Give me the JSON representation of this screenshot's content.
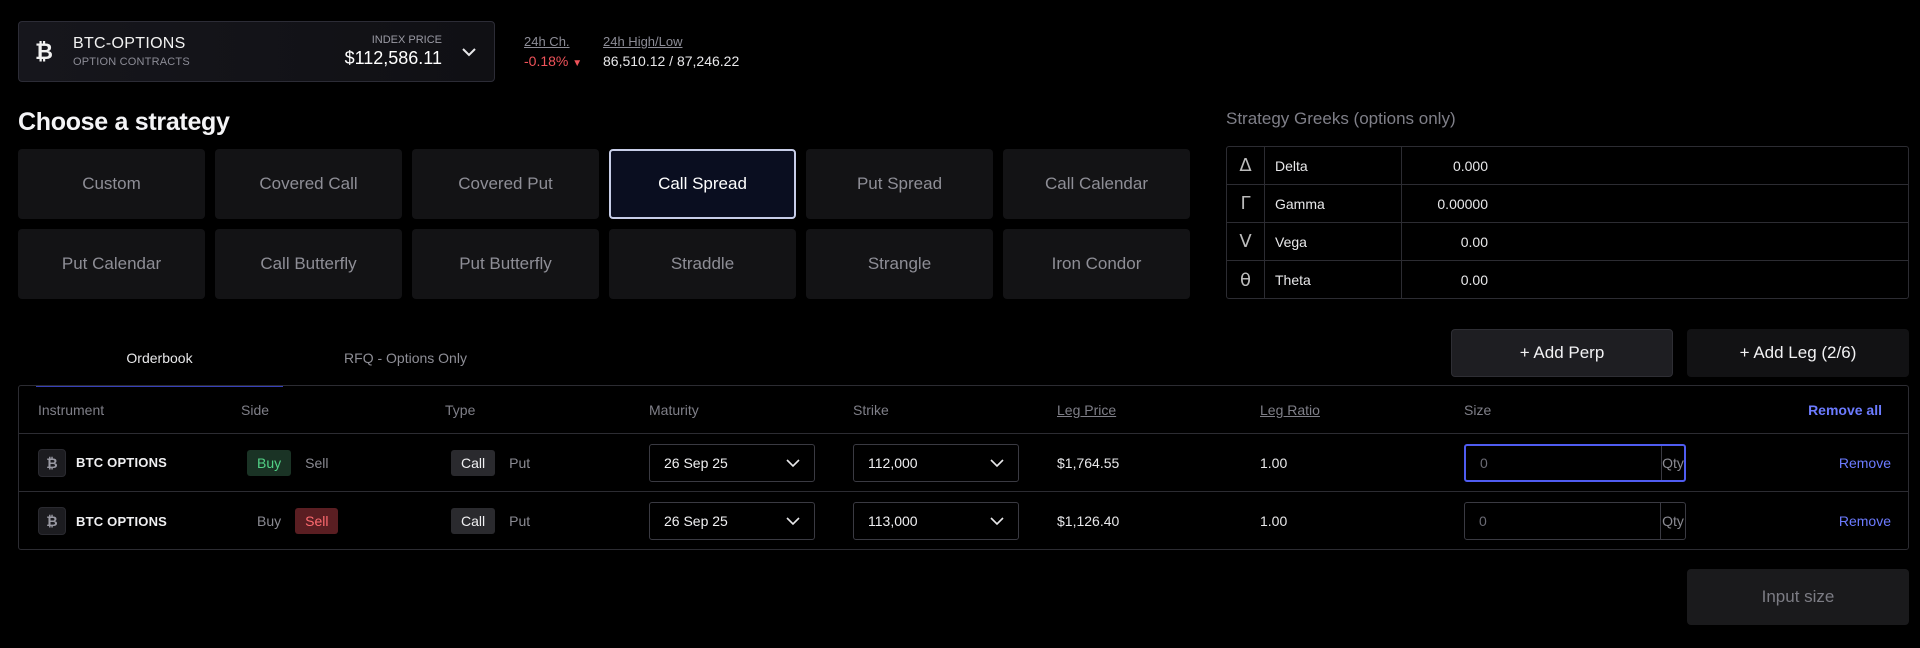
{
  "market": {
    "name": "BTC-OPTIONS",
    "subtitle": "OPTION CONTRACTS",
    "index_label": "INDEX PRICE",
    "index_price": "$112,586.11",
    "icon": "bitcoin-icon"
  },
  "stats": {
    "change_label": "24h Ch.",
    "change_value": "-0.18%",
    "highlow_label": "24h High/Low",
    "highlow_value": "86,510.12 / 87,246.22"
  },
  "strategy": {
    "title": "Choose a strategy",
    "options": [
      "Custom",
      "Covered Call",
      "Covered Put",
      "Call Spread",
      "Put Spread",
      "Call Calendar",
      "Put Calendar",
      "Call Butterfly",
      "Put Butterfly",
      "Straddle",
      "Strangle",
      "Iron Condor"
    ],
    "selected": "Call Spread"
  },
  "greeks": {
    "title": "Strategy Greeks (options only)",
    "rows": [
      {
        "symbol": "Δ",
        "name": "Delta",
        "value": "0.000"
      },
      {
        "symbol": "Γ",
        "name": "Gamma",
        "value": "0.00000"
      },
      {
        "symbol": "V",
        "name": "Vega",
        "value": "0.00"
      },
      {
        "symbol": "θ",
        "name": "Theta",
        "value": "0.00"
      }
    ]
  },
  "tabs": {
    "orderbook": "Orderbook",
    "rfq": "RFQ - Options Only"
  },
  "actions": {
    "add_perp": "+ Add Perp",
    "add_leg": "+ Add Leg (2/6)",
    "input_size": "Input size"
  },
  "table": {
    "headers": {
      "instrument": "Instrument",
      "side": "Side",
      "type": "Type",
      "maturity": "Maturity",
      "strike": "Strike",
      "leg_price": "Leg Price",
      "leg_ratio": "Leg Ratio",
      "size": "Size",
      "remove_all": "Remove all"
    },
    "rows": [
      {
        "instrument": "BTC OPTIONS",
        "buy": "Buy",
        "sell": "Sell",
        "side": "Buy",
        "call": "Call",
        "put": "Put",
        "maturity": "26 Sep 25",
        "strike": "112,000",
        "leg_price": "$1,764.55",
        "leg_ratio": "1.00",
        "size_placeholder": "0",
        "qty": "Qty",
        "remove": "Remove"
      },
      {
        "instrument": "BTC OPTIONS",
        "buy": "Buy",
        "sell": "Sell",
        "side": "Sell",
        "call": "Call",
        "put": "Put",
        "maturity": "26 Sep 25",
        "strike": "113,000",
        "leg_price": "$1,126.40",
        "leg_ratio": "1.00",
        "size_placeholder": "0",
        "qty": "Qty",
        "remove": "Remove"
      }
    ]
  },
  "colors": {
    "accent": "#6c7bff",
    "negative": "#f0535a",
    "buy": "#52d186",
    "sell": "#ff6b70"
  }
}
